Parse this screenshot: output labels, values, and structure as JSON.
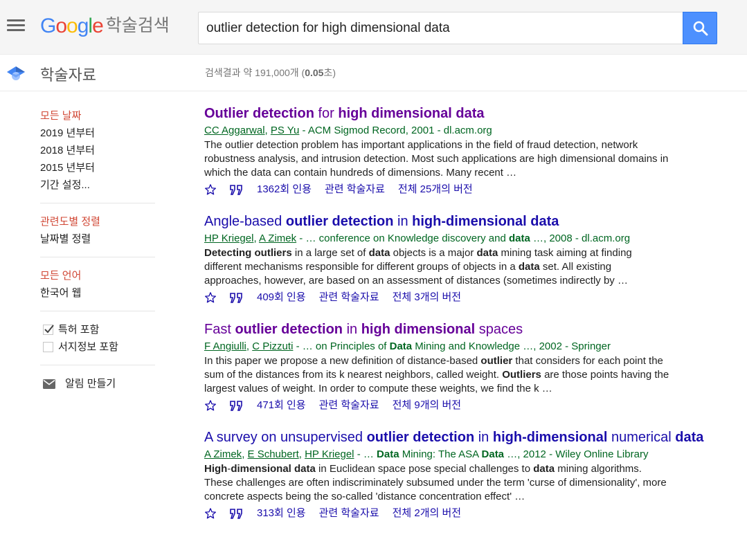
{
  "header": {
    "menu_icon": "hamburger-menu-icon",
    "logo_text": "Google",
    "logo_sub": "학술검색",
    "search_query": "outlier detection for high dimensional data",
    "search_icon": "search-icon"
  },
  "subheader": {
    "scholar_icon": "scholar-cap-icon",
    "label": "학술자료",
    "stats_prefix": "검색결과 약 191,000개 (",
    "stats_time": "0.05",
    "stats_suffix": "초)"
  },
  "sidebar": {
    "date_filters": [
      "모든 날짜",
      "2019 년부터",
      "2018 년부터",
      "2015 년부터",
      "기간 설정..."
    ],
    "sort_options": [
      "관련도별 정렬",
      "날짜별 정렬"
    ],
    "language_options": [
      "모든 언어",
      "한국어 웹"
    ],
    "checkboxes": [
      {
        "label": "특허 포함",
        "checked": true
      },
      {
        "label": "서지정보 포함",
        "checked": false
      }
    ],
    "alert_label": "알림 만들기",
    "alert_icon": "mail-icon"
  },
  "results": [
    {
      "title_segments": [
        [
          "Outlier detection",
          true
        ],
        [
          " for ",
          false
        ],
        [
          "high dimensional data",
          true
        ]
      ],
      "visited": true,
      "authors": [
        "CC Aggarwal",
        "PS Yu"
      ],
      "meta_segments": [
        [
          " - ACM Sigmod Record, 2001 - dl.acm.org",
          false
        ]
      ],
      "snippet_segments": [
        [
          "The outlier detection problem has important applications in the field of fraud detection, network robustness analysis, and intrusion detection. Most such applications are high dimensional domains in which the data can contain hundreds of dimensions. Many recent …",
          false
        ]
      ],
      "cited": "1362회 인용",
      "related": "관련 학술자료",
      "versions": "전체 25개의 버전"
    },
    {
      "title_segments": [
        [
          "Angle-based ",
          false
        ],
        [
          "outlier detection",
          true
        ],
        [
          " in ",
          false
        ],
        [
          "high-dimensional data",
          true
        ]
      ],
      "visited": false,
      "authors": [
        "HP Kriegel",
        "A Zimek"
      ],
      "meta_segments": [
        [
          " - … conference on Knowledge discovery and ",
          false
        ],
        [
          "data",
          true
        ],
        [
          " …, 2008 - dl.acm.org",
          false
        ]
      ],
      "snippet_segments": [
        [
          "Detecting outliers",
          true
        ],
        [
          " in a large set of ",
          false
        ],
        [
          "data",
          true
        ],
        [
          " objects is a major ",
          false
        ],
        [
          "data",
          true
        ],
        [
          " mining task aiming at finding different mechanisms responsible for different groups of objects in a ",
          false
        ],
        [
          "data",
          true
        ],
        [
          " set. All existing approaches, however, are based on an assessment of distances (sometimes indirectly by …",
          false
        ]
      ],
      "cited": "409회 인용",
      "related": "관련 학술자료",
      "versions": "전체 3개의 버전"
    },
    {
      "title_segments": [
        [
          "Fast ",
          false
        ],
        [
          "outlier detection",
          true
        ],
        [
          " in ",
          false
        ],
        [
          "high dimensional",
          true
        ],
        [
          " spaces",
          false
        ]
      ],
      "visited": true,
      "authors": [
        "F Angiulli",
        "C Pizzuti"
      ],
      "meta_segments": [
        [
          " - … on Principles of ",
          false
        ],
        [
          "Data",
          true
        ],
        [
          " Mining and Knowledge …, 2002 - Springer",
          false
        ]
      ],
      "snippet_segments": [
        [
          "In this paper we propose a new definition of distance-based ",
          false
        ],
        [
          "outlier",
          true
        ],
        [
          " that considers for each point the sum of the distances from its k nearest neighbors, called weight. ",
          false
        ],
        [
          "Outliers",
          true
        ],
        [
          " are those points having the largest values of weight. In order to compute these weights, we find the k …",
          false
        ]
      ],
      "cited": "471회 인용",
      "related": "관련 학술자료",
      "versions": "전체 9개의 버전"
    },
    {
      "title_segments": [
        [
          "A survey on unsupervised ",
          false
        ],
        [
          "outlier detection",
          true
        ],
        [
          " in ",
          false
        ],
        [
          "high-dimensional",
          true
        ],
        [
          " numerical ",
          false
        ],
        [
          "data",
          true
        ]
      ],
      "visited": false,
      "authors": [
        "A Zimek",
        "E Schubert",
        "HP Kriegel"
      ],
      "meta_segments": [
        [
          " - … ",
          false
        ],
        [
          "Data",
          true
        ],
        [
          " Mining: The ASA ",
          false
        ],
        [
          "Data",
          true
        ],
        [
          " …, 2012 - Wiley Online Library",
          false
        ]
      ],
      "snippet_segments": [
        [
          "High",
          true
        ],
        [
          "-",
          false
        ],
        [
          "dimensional data",
          true
        ],
        [
          " in Euclidean space pose special challenges to ",
          false
        ],
        [
          "data",
          true
        ],
        [
          " mining algorithms. These challenges are often indiscriminately subsumed under the term 'curse of dimensionality', more concrete aspects being the so-called 'distance concentration effect' …",
          false
        ]
      ],
      "cited": "313회 인용",
      "related": "관련 학술자료",
      "versions": "전체 2개의 버전"
    }
  ],
  "colors": {
    "link": "#1a0dab",
    "visited": "#660099",
    "meta_green": "#006621",
    "active_red": "#d14836",
    "search_button": "#4d90fe"
  }
}
